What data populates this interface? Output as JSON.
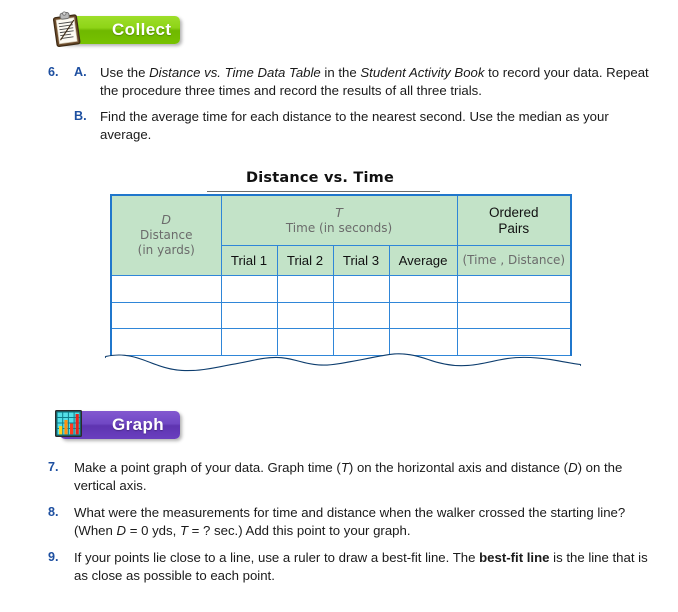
{
  "sections": [
    {
      "id": "collect",
      "label": "Collect",
      "icon": "clipboard-icon",
      "color": "#7ec610"
    },
    {
      "id": "graph",
      "label": "Graph",
      "icon": "bar-chart-icon",
      "color": "#6a3fbf"
    }
  ],
  "items": {
    "q6": {
      "number": "6.",
      "parts": [
        {
          "letter": "A.",
          "text_segments": [
            {
              "text": "Use the ",
              "style": "normal"
            },
            {
              "text": "Distance vs. Time Data Table",
              "style": "italic"
            },
            {
              "text": " in the ",
              "style": "normal"
            },
            {
              "text": "Student Activity Book",
              "style": "italic"
            },
            {
              "text": " to record your data. Repeat the procedure three times and record the results of all three trials.",
              "style": "normal"
            }
          ]
        },
        {
          "letter": "B.",
          "text_segments": [
            {
              "text": "Find the average time for each distance to the nearest second. Use the median as your average.",
              "style": "normal"
            }
          ]
        }
      ]
    },
    "q7": {
      "number": "7.",
      "text_segments": [
        {
          "text": "Make a point graph of your data. Graph time (",
          "style": "normal"
        },
        {
          "text": "T",
          "style": "italic"
        },
        {
          "text": ") on the horizontal axis and distance (",
          "style": "normal"
        },
        {
          "text": "D",
          "style": "italic"
        },
        {
          "text": ") on the vertical axis.",
          "style": "normal"
        }
      ]
    },
    "q8": {
      "number": "8.",
      "text_segments": [
        {
          "text": "What were the measurements for time and distance when the walker crossed the starting line? (When ",
          "style": "normal"
        },
        {
          "text": "D",
          "style": "italic"
        },
        {
          "text": " = 0 yds, ",
          "style": "normal"
        },
        {
          "text": "T",
          "style": "italic"
        },
        {
          "text": " = ? sec.) Add this point to your graph.",
          "style": "normal"
        }
      ]
    },
    "q9": {
      "number": "9.",
      "text_segments": [
        {
          "text": "If your points lie close to a line, use a ruler to draw a best-fit line. The ",
          "style": "normal"
        },
        {
          "text": "best-fit line",
          "style": "bold"
        },
        {
          "text": " is the line that is as close as possible to each point.",
          "style": "normal"
        }
      ]
    }
  },
  "table": {
    "title": "Distance vs. Time",
    "distance_header": {
      "symbol": "D",
      "name": "Distance",
      "unit": "(in yards)"
    },
    "time_header": {
      "symbol": "T",
      "name": "Time (in seconds)"
    },
    "ordered_pairs_header": {
      "line1": "Ordered",
      "line2": "Pairs",
      "sub": "(Time , Distance)"
    },
    "trial_columns": [
      "Trial 1",
      "Trial 2",
      "Trial 3",
      "Average"
    ],
    "empty_rows": 3,
    "header_fill": "#c3e3c8",
    "border_color": "#2f86d8"
  }
}
